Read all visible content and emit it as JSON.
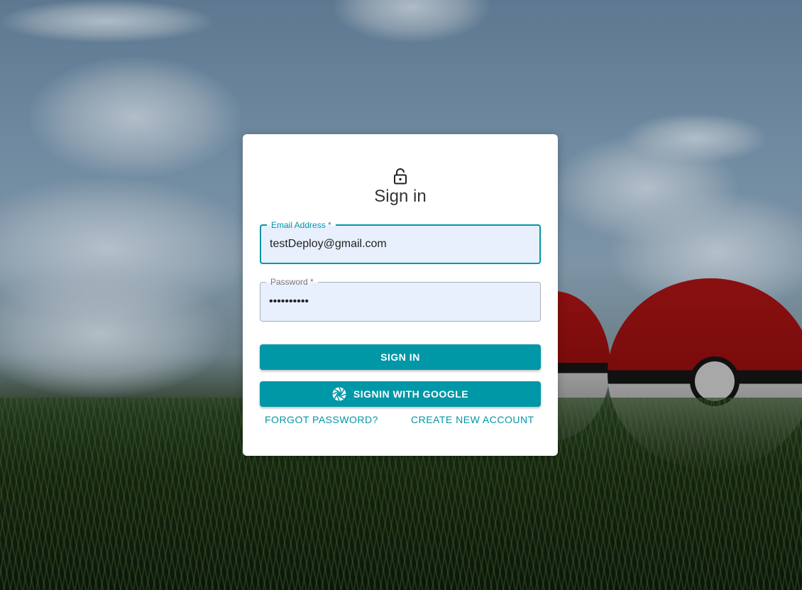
{
  "page": {
    "title": "Sign in"
  },
  "form": {
    "email": {
      "label": "Email Address *",
      "value": "testDeploy@gmail.com"
    },
    "password": {
      "label": "Password *",
      "value": "••••••••••"
    },
    "signin_button": "SIGN IN",
    "google_button": "SIGNIN WITH GOOGLE",
    "forgot_link": "FORGOT PASSWORD?",
    "create_link": "CREATE NEW ACCOUNT"
  },
  "icons": {
    "header": "lock-open-icon",
    "google": "aperture-icon"
  },
  "colors": {
    "accent": "#0097a7",
    "field_bg": "#e8f0fe",
    "card_bg": "#ffffff"
  }
}
